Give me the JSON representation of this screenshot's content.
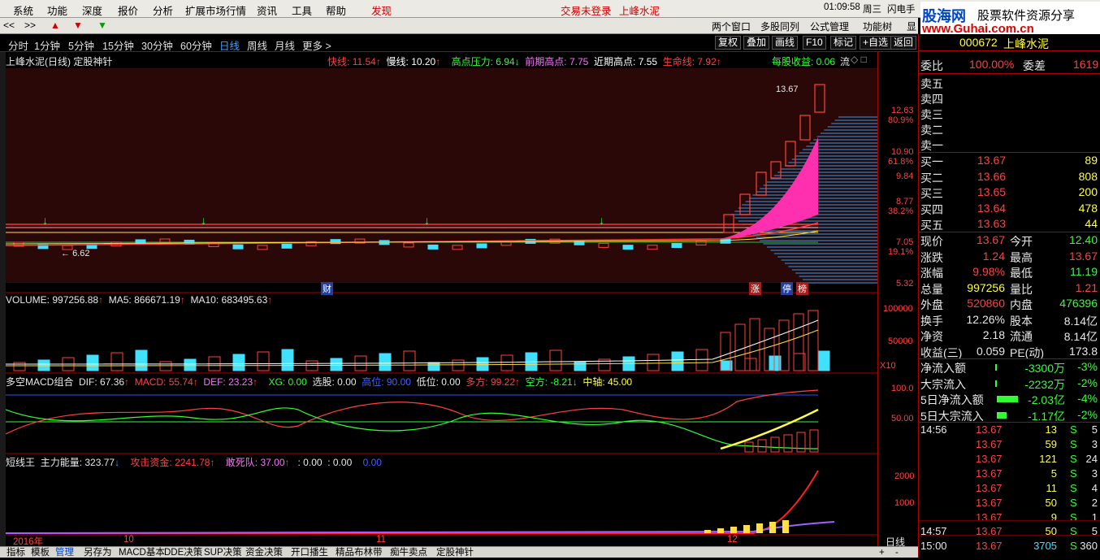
{
  "menu": {
    "items": [
      "系统",
      "功能",
      "深度",
      "报价",
      "分析",
      "扩展市场行情",
      "资讯",
      "工具",
      "帮助"
    ],
    "discover": "发现",
    "login_status": "交易未登录",
    "stock_name": "上峰水泥",
    "time": "01:09:58",
    "weekday": "周三",
    "flash": "闪电手",
    "brand": "股海网",
    "brand_right": "股票软件资源分享",
    "url": "www.Guhai.com.cn"
  },
  "toolbar2": {
    "nav_prev": "<<",
    "nav_next": ">>",
    "right_buttons": [
      "两个窗口",
      "多股同列",
      "公式管理",
      "功能树",
      "显"
    ]
  },
  "periods": [
    "分时",
    "1分钟",
    "5分钟",
    "15分钟",
    "30分钟",
    "60分钟",
    "日线",
    "周线",
    "月线",
    "更多 >"
  ],
  "period_active": "日线",
  "right_tools": [
    "复权",
    "叠加",
    "画线",
    "F10",
    "标记",
    "+自选",
    "返回"
  ],
  "main_chart": {
    "title": "上峰水泥(日线) 定股神针",
    "indicators": [
      {
        "name": "快线:",
        "value": "11.54",
        "arrow": "↑",
        "color": "#ff4040"
      },
      {
        "name": "慢线:",
        "value": "10.20",
        "arrow": "↑",
        "color": "#ffffff"
      },
      {
        "name": "高点压力:",
        "value": "6.94",
        "arrow": "↓",
        "color": "#30ff30"
      },
      {
        "name": "前期高点:",
        "value": "7.75",
        "arrow": "",
        "color": "#ff70ff"
      },
      {
        "name": "近期高点:",
        "value": "7.55",
        "arrow": "",
        "color": "#ffffff"
      },
      {
        "name": "生命线:",
        "value": "7.92",
        "arrow": "↑",
        "color": "#ff4040"
      }
    ],
    "eps": "每股收益: 0.06",
    "eps_suffix": "流",
    "high_label": "13.67",
    "low_label": "6.62",
    "markers": [
      "财",
      "涨",
      "停",
      "榜"
    ],
    "price_axis": [
      "12.63",
      "80.9%",
      "10.90",
      "61.8%",
      "9.84",
      "8.77",
      "38.2%",
      "7.05",
      "19.1%",
      "5.32"
    ]
  },
  "volume_panel": {
    "title": "VOLUME: 997256.88",
    "ma5": "MA5: 866671.19",
    "ma10": "MA10: 683495.63",
    "axis": [
      "100000",
      "50000",
      "X10"
    ]
  },
  "macd_panel": {
    "title": "多空MACD组合",
    "items": [
      {
        "text": "DIF: 67.36",
        "color": "#e8e8e8"
      },
      {
        "text": "MACD: 55.74",
        "color": "#ff4040"
      },
      {
        "text": "DEF: 23.23",
        "color": "#ff70ff"
      },
      {
        "text": "XG: 0.00",
        "color": "#30ff30"
      },
      {
        "text": "选股: 0.00",
        "color": "#e8e8e8"
      },
      {
        "text": "高位: 90.00",
        "color": "#4060ff"
      },
      {
        "text": "低位: 0.00",
        "color": "#e8e8e8"
      },
      {
        "text": "多方: 99.22",
        "color": "#ff4040"
      },
      {
        "text": "空方: -8.21",
        "color": "#30ff30"
      },
      {
        "text": "中轴: 45.00",
        "color": "#ffff40"
      }
    ],
    "axis": [
      "100.0",
      "50.00"
    ]
  },
  "short_panel": {
    "title": "短线王",
    "items": [
      {
        "text": "主力能量: 323.77",
        "color": "#e8e8e8"
      },
      {
        "text": "攻击资金: 2241.78",
        "color": "#ff4040"
      },
      {
        "text": "敢死队: 37.00",
        "color": "#ff70ff"
      },
      {
        "text": ": 0.00",
        "color": "#e8e8e8"
      },
      {
        "text": ": 0.00",
        "color": "#e8e8e8"
      },
      {
        "text": "0.00",
        "color": "#4060ff"
      }
    ],
    "axis": [
      "2000",
      "1000"
    ]
  },
  "date_axis": [
    "2016年",
    "10",
    "11",
    "12"
  ],
  "date_axis_right": "日线",
  "bottom_tabs": [
    "指标",
    "模板",
    "管理",
    "另存为",
    "MACD基本",
    "DDE决策",
    "SUP决策",
    "资金决策",
    "开口播生",
    "精品布林带",
    "痴牛卖点",
    "定股神针"
  ],
  "quote": {
    "code": "000672",
    "name": "上峰水泥",
    "webi_label": "委比",
    "webi": "100.00%",
    "wecha_label": "委差",
    "wecha": "1619",
    "asks": [
      {
        "label": "卖五",
        "price": "",
        "vol": ""
      },
      {
        "label": "卖四",
        "price": "",
        "vol": ""
      },
      {
        "label": "卖三",
        "price": "",
        "vol": ""
      },
      {
        "label": "卖二",
        "price": "",
        "vol": ""
      },
      {
        "label": "卖一",
        "price": "",
        "vol": ""
      }
    ],
    "bids": [
      {
        "label": "买一",
        "price": "13.67",
        "vol": "89"
      },
      {
        "label": "买二",
        "price": "13.66",
        "vol": "808"
      },
      {
        "label": "买三",
        "price": "13.65",
        "vol": "200"
      },
      {
        "label": "买四",
        "price": "13.64",
        "vol": "478"
      },
      {
        "label": "买五",
        "price": "13.63",
        "vol": "44"
      }
    ],
    "stats": [
      {
        "l1": "现价",
        "v1": "13.67",
        "c1": "#ff4040",
        "l2": "今开",
        "v2": "12.40",
        "c2": "#30ff30"
      },
      {
        "l1": "涨跌",
        "v1": "1.24",
        "c1": "#ff4040",
        "l2": "最高",
        "v2": "13.67",
        "c2": "#ff4040"
      },
      {
        "l1": "涨幅",
        "v1": "9.98%",
        "c1": "#ff4040",
        "l2": "最低",
        "v2": "11.19",
        "c2": "#30ff30"
      },
      {
        "l1": "总量",
        "v1": "997256",
        "c1": "#ffff40",
        "l2": "量比",
        "v2": "1.21",
        "c2": "#ff4040"
      },
      {
        "l1": "外盘",
        "v1": "520860",
        "c1": "#ff4040",
        "l2": "内盘",
        "v2": "476396",
        "c2": "#30ff30"
      },
      {
        "l1": "换手",
        "v1": "12.26%",
        "c1": "#e8e8e8",
        "l2": "股本",
        "v2": "8.14亿",
        "c2": "#e8e8e8"
      },
      {
        "l1": "净资",
        "v1": "2.18",
        "c1": "#e8e8e8",
        "l2": "流通",
        "v2": "8.14亿",
        "c2": "#e8e8e8"
      },
      {
        "l1": "收益(三)",
        "v1": "0.059",
        "c1": "#e8e8e8",
        "l2": "PE(动)",
        "v2": "173.8",
        "c2": "#e8e8e8"
      }
    ],
    "flows": [
      {
        "label": "净流入额",
        "value": "-3300万",
        "pct": "-3%"
      },
      {
        "label": "大宗流入",
        "value": "-2232万",
        "pct": "-2%"
      },
      {
        "label": "5日净流入额",
        "value": "-2.03亿",
        "pct": "-4%"
      },
      {
        "label": "5日大宗流入",
        "value": "-1.17亿",
        "pct": "-2%"
      }
    ],
    "ticks": [
      {
        "time": "14:56",
        "price": "13.67",
        "vol": "13",
        "side": "S",
        "n": "5"
      },
      {
        "time": "",
        "price": "13.67",
        "vol": "59",
        "side": "S",
        "n": "3"
      },
      {
        "time": "",
        "price": "13.67",
        "vol": "121",
        "side": "S",
        "n": "24"
      },
      {
        "time": "",
        "price": "13.67",
        "vol": "5",
        "side": "S",
        "n": "3"
      },
      {
        "time": "",
        "price": "13.67",
        "vol": "11",
        "side": "S",
        "n": "4"
      },
      {
        "time": "",
        "price": "13.67",
        "vol": "50",
        "side": "S",
        "n": "2"
      },
      {
        "time": "",
        "price": "13.67",
        "vol": "9",
        "side": "S",
        "n": "1"
      },
      {
        "time": "14:57",
        "price": "13.67",
        "vol": "50",
        "side": "S",
        "n": "5"
      },
      {
        "time": "15:00",
        "price": "13.67",
        "vol": "3705",
        "side": "S",
        "n": "360"
      }
    ]
  }
}
